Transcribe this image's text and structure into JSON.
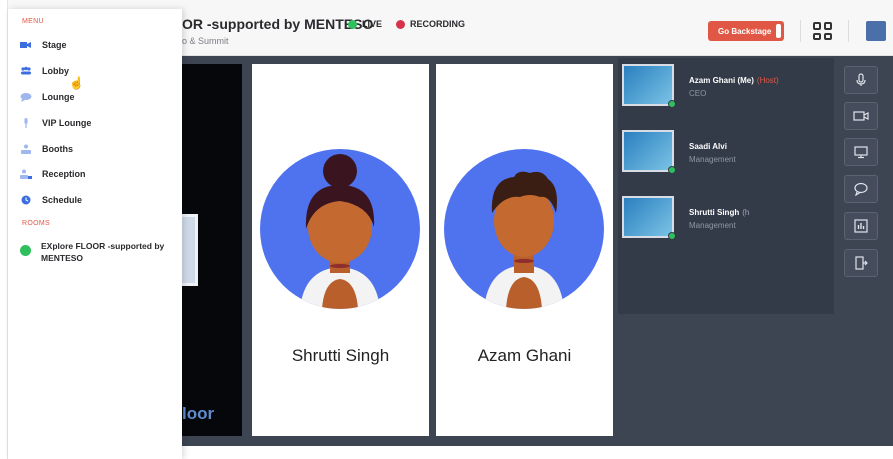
{
  "header": {
    "event_title": "OR -supported by MENTESO",
    "event_subtitle": "o & Summit",
    "live_label": "LIVE",
    "recording_label": "RECORDING",
    "backstage_label": "Go Backstage"
  },
  "sidebar": {
    "menu_label": "MENU",
    "items": [
      {
        "label": "Stage",
        "icon": "camera-icon"
      },
      {
        "label": "Lobby",
        "icon": "people-icon"
      },
      {
        "label": "Lounge",
        "icon": "chat-icon"
      },
      {
        "label": "VIP Lounge",
        "icon": "mic-icon"
      },
      {
        "label": "Booths",
        "icon": "booth-icon"
      },
      {
        "label": "Reception",
        "icon": "reception-icon"
      },
      {
        "label": "Schedule",
        "icon": "clock-icon"
      }
    ],
    "rooms_label": "ROOMS",
    "room": "EXplore FLOOR -supported by MENTESO"
  },
  "stage": {
    "speakers": [
      {
        "name": "Shrutti Singh"
      },
      {
        "name": "Azam Ghani"
      }
    ],
    "video_logo": "loor"
  },
  "participants": [
    {
      "name": "Azam Ghani (Me)",
      "tag": "(Host)",
      "role": "CEO"
    },
    {
      "name": "Saadi Alvi",
      "tag": "",
      "role": "Management"
    },
    {
      "name": "Shrutti Singh",
      "tag": "(h",
      "role": "Management"
    }
  ],
  "controls": [
    "mic-icon",
    "video-icon",
    "screen-share-icon",
    "chat-bubble-icon",
    "poll-icon",
    "exit-icon"
  ],
  "colors": {
    "accent": "#e05845",
    "live_dot": "#2fbf5c",
    "stage_bg": "#3d4452",
    "avatar_bg": "#4f72ee"
  }
}
